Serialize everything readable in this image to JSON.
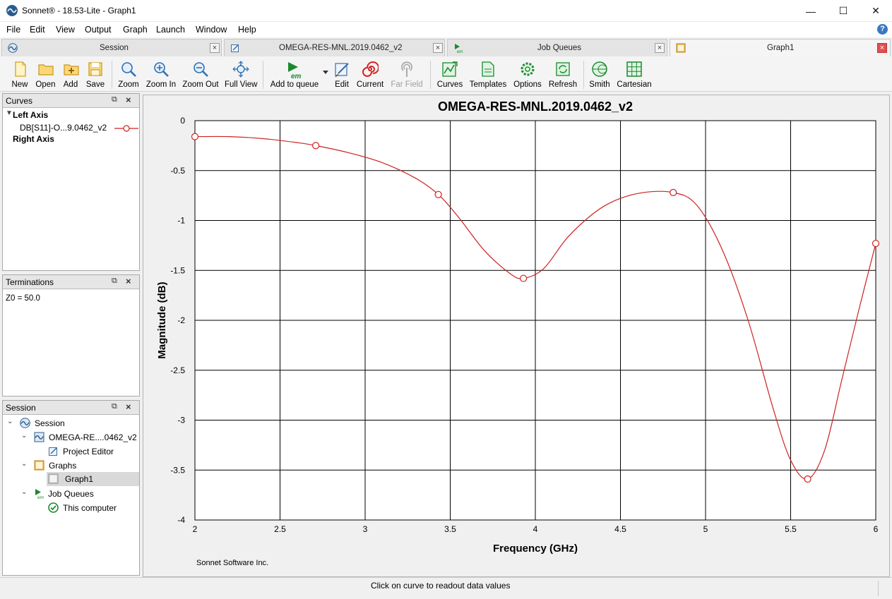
{
  "window": {
    "title": "Sonnet® - 18.53-Lite - Graph1",
    "minimize": "—",
    "maximize": "☐",
    "close": "✕"
  },
  "menu": [
    "File",
    "Edit",
    "View",
    "Output",
    "Graph",
    "Launch",
    "Window",
    "Help"
  ],
  "tabs": [
    {
      "label": "Session",
      "icon": "sonnet-wave-icon",
      "close": "×"
    },
    {
      "label": "OMEGA-RES-MNL.2019.0462_v2",
      "icon": "project-editor-icon",
      "close": "×"
    },
    {
      "label": "Job Queues",
      "icon": "em-queue-icon",
      "close": "×"
    },
    {
      "label": "Graph1",
      "icon": "graph-icon",
      "close": "×"
    }
  ],
  "toolbar": {
    "new": "New",
    "open": "Open",
    "add": "Add",
    "save": "Save",
    "zoom": "Zoom",
    "zoom_in": "Zoom In",
    "zoom_out": "Zoom Out",
    "full_view": "Full View",
    "add_to_queue": "Add to queue",
    "edit": "Edit",
    "current": "Current",
    "far_field": "Far Field",
    "curves": "Curves",
    "templates": "Templates",
    "options": "Options",
    "refresh": "Refresh",
    "smith": "Smith",
    "cartesian": "Cartesian"
  },
  "curves_panel": {
    "title": "Curves",
    "left_axis": "Left Axis",
    "curve_label": "DB[S11]-O...9.0462_v2",
    "right_axis": "Right Axis",
    "curve_color": "#cc2222"
  },
  "terminations_panel": {
    "title": "Terminations",
    "z0": "Z0 = 50.0"
  },
  "session_panel": {
    "title": "Session",
    "tree": {
      "session": "Session",
      "project": "OMEGA-RE....0462_v2",
      "project_editor": "Project Editor",
      "graphs": "Graphs",
      "graph1": "Graph1",
      "job_queues": "Job Queues",
      "this_computer": "This computer"
    }
  },
  "chart_data": {
    "type": "line",
    "title": "OMEGA-RES-MNL.2019.0462_v2",
    "xlabel": "Frequency (GHz)",
    "ylabel": "Magnitude (dB)",
    "xlim": [
      2,
      6
    ],
    "ylim": [
      -4,
      0
    ],
    "x_ticks": [
      "2",
      "2.5",
      "3",
      "3.5",
      "4",
      "4.5",
      "5",
      "5.5",
      "6"
    ],
    "y_ticks": [
      "0",
      "-0.5",
      "-1",
      "-1.5",
      "-2",
      "-2.5",
      "-3",
      "-3.5",
      "-4"
    ],
    "grid": true,
    "series": [
      {
        "name": "DB[S11]-O...9.0462_v2",
        "color": "#cc2222",
        "x": [
          2.0,
          2.71,
          3.43,
          3.93,
          4.81,
          5.6,
          6.0
        ],
        "y": [
          -0.16,
          -0.25,
          -0.74,
          -1.58,
          -0.72,
          -3.59,
          -1.23
        ],
        "curve_x": [
          2.0,
          2.2,
          2.4,
          2.6,
          2.71,
          2.9,
          3.1,
          3.3,
          3.43,
          3.55,
          3.7,
          3.85,
          3.93,
          4.05,
          4.2,
          4.4,
          4.6,
          4.81,
          4.95,
          5.1,
          5.25,
          5.4,
          5.5,
          5.6,
          5.7,
          5.8,
          5.9,
          6.0
        ],
        "curve_y": [
          -0.16,
          -0.16,
          -0.18,
          -0.22,
          -0.25,
          -0.32,
          -0.42,
          -0.58,
          -0.74,
          -0.97,
          -1.3,
          -1.53,
          -1.58,
          -1.48,
          -1.15,
          -0.86,
          -0.73,
          -0.72,
          -0.85,
          -1.3,
          -2.0,
          -2.9,
          -3.4,
          -3.59,
          -3.3,
          -2.6,
          -1.9,
          -1.23
        ]
      }
    ],
    "footer": "Sonnet Software Inc."
  },
  "status": {
    "text": "Click on curve to readout data values"
  }
}
